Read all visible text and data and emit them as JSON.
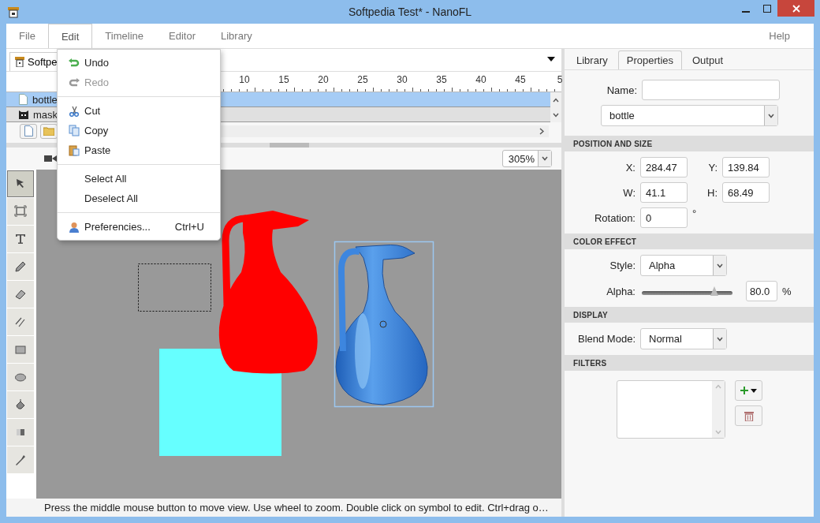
{
  "window": {
    "title": "Softpedia Test* - NanoFL"
  },
  "menu_bar": {
    "items": [
      {
        "label": "File",
        "selected": false
      },
      {
        "label": "Edit",
        "selected": true
      },
      {
        "label": "Timeline",
        "selected": false
      },
      {
        "label": "Editor",
        "selected": false
      },
      {
        "label": "Library",
        "selected": false
      }
    ],
    "help": "Help"
  },
  "edit_menu": {
    "items": [
      {
        "kind": "item",
        "label": "Undo",
        "disabled": false
      },
      {
        "kind": "item",
        "label": "Redo",
        "disabled": true
      },
      {
        "kind": "separator"
      },
      {
        "kind": "item",
        "label": "Cut",
        "disabled": false
      },
      {
        "kind": "item",
        "label": "Copy",
        "disabled": false
      },
      {
        "kind": "item",
        "label": "Paste",
        "disabled": false
      },
      {
        "kind": "separator"
      },
      {
        "kind": "item",
        "label": "Select All",
        "disabled": false
      },
      {
        "kind": "item",
        "label": "Deselect All",
        "disabled": false
      },
      {
        "kind": "separator"
      },
      {
        "kind": "item",
        "label": "Preferencies...",
        "shortcut": "Ctrl+U",
        "disabled": false
      }
    ]
  },
  "document_tab": {
    "label": "Softpe"
  },
  "timeline": {
    "ruler": [
      "10",
      "15",
      "20",
      "25",
      "30",
      "35",
      "40",
      "45",
      "5"
    ],
    "layers": [
      {
        "name": "bottle",
        "selected": true
      },
      {
        "name": "mask",
        "selected": false
      }
    ]
  },
  "zoom": {
    "value": "305%"
  },
  "tools": [
    {
      "selected": true
    },
    {
      "selected": false
    },
    {
      "selected": false
    },
    {
      "selected": false
    },
    {
      "selected": false
    },
    {
      "selected": false
    },
    {
      "selected": false
    },
    {
      "selected": false
    },
    {
      "selected": false
    },
    {
      "selected": false
    },
    {
      "selected": false
    }
  ],
  "status_bar": "Press the middle mouse button to move view. Use wheel to zoom. Double click on symbol to edit. Ctrl+drag o…",
  "panel": {
    "tabs": [
      {
        "label": "Library",
        "selected": false
      },
      {
        "label": "Properties",
        "selected": true
      },
      {
        "label": "Output",
        "selected": false
      }
    ],
    "name": {
      "label": "Name:"
    },
    "symbol": "bottle",
    "position_and_size": {
      "header": "POSITION AND SIZE",
      "x": {
        "label": "X:",
        "value": "284.47"
      },
      "y": {
        "label": "Y:",
        "value": "139.84"
      },
      "w": {
        "label": "W:",
        "value": "41.1"
      },
      "h": {
        "label": "H:",
        "value": "68.49"
      },
      "rotation": {
        "label": "Rotation:",
        "value": "0",
        "unit": "°"
      }
    },
    "color_effect": {
      "header": "COLOR EFFECT",
      "style": {
        "label": "Style:",
        "value": "Alpha"
      },
      "alpha": {
        "label": "Alpha:",
        "level": 0.8,
        "value": "80.0",
        "unit": "%"
      }
    },
    "display": {
      "header": "DISPLAY",
      "blend": {
        "label": "Blend Mode:",
        "value": "Normal"
      }
    },
    "filters": {
      "header": "FILTERS"
    }
  }
}
